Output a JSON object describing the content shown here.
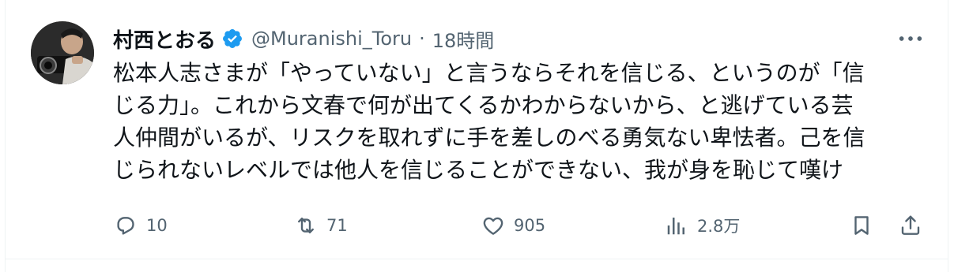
{
  "tweet": {
    "author_name": "村西とおる",
    "handle": "@Muranishi_Toru",
    "separator": "·",
    "time": "18時間",
    "text_lines": [
      "松本人志さまが「やっていない」と言うならそれを信じる、というのが「信",
      "じる力」。これから文春で何が出てくるかわからないから、と逃げている芸",
      "人仲間がいるが、リスクを取れずに手を差しのべる勇気ない卑怯者。己を信",
      "じられないレベルでは他人を信じることができない、我が身を恥じて嘆け"
    ]
  },
  "actions": {
    "reply_count": "10",
    "retweet_count": "71",
    "like_count": "905",
    "views_count": "2.8万"
  },
  "icons": {
    "verified": "verified-badge-icon",
    "more": "more-icon",
    "reply": "reply-icon",
    "retweet": "retweet-icon",
    "like": "heart-icon",
    "views": "views-icon",
    "bookmark": "bookmark-icon",
    "share": "share-icon"
  },
  "colors": {
    "verified_blue": "#1d9bf0",
    "text": "#0f1419",
    "secondary": "#536471",
    "border": "#eff3f4"
  }
}
